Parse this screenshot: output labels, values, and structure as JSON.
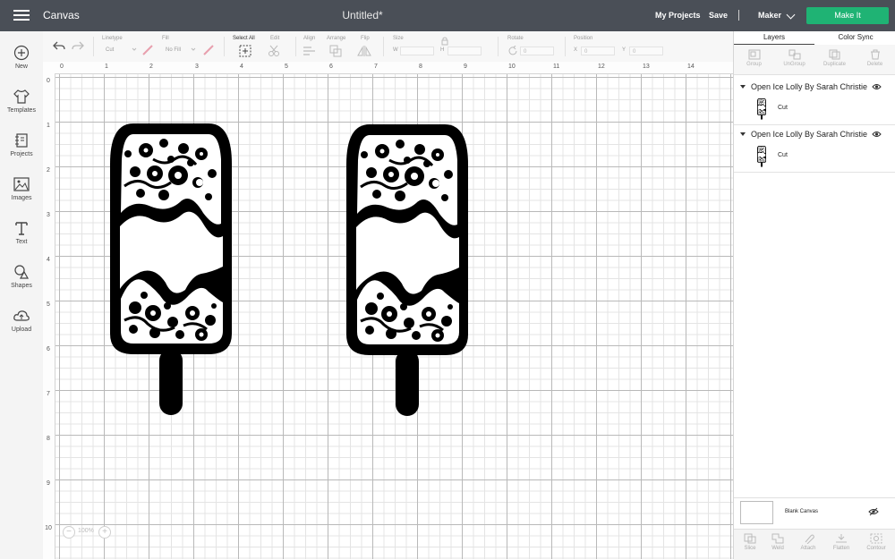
{
  "header": {
    "app_title": "Canvas",
    "document_title": "Untitled*",
    "my_projects": "My Projects",
    "save": "Save",
    "machine": "Maker",
    "make_it": "Make It"
  },
  "sidebar": {
    "items": [
      {
        "label": "New",
        "icon": "plus-circle-icon"
      },
      {
        "label": "Templates",
        "icon": "shirt-icon"
      },
      {
        "label": "Projects",
        "icon": "notebook-icon"
      },
      {
        "label": "Images",
        "icon": "image-icon"
      },
      {
        "label": "Text",
        "icon": "text-icon"
      },
      {
        "label": "Shapes",
        "icon": "shapes-icon"
      },
      {
        "label": "Upload",
        "icon": "cloud-upload-icon"
      }
    ]
  },
  "toolbar": {
    "linetype_label": "Linetype",
    "linetype_value": "Cut",
    "fill_label": "Fill",
    "fill_value": "No Fill",
    "select_all": "Select All",
    "edit": "Edit",
    "align": "Align",
    "arrange": "Arrange",
    "flip": "Flip",
    "size": "Size",
    "width_label": "W",
    "height_label": "H",
    "rotate": "Rotate",
    "position": "Position",
    "x_label": "X",
    "y_label": "Y",
    "rotate_value": "0",
    "x_value": "0",
    "y_value": "0"
  },
  "rulers": {
    "top": [
      "0",
      "1",
      "2",
      "3",
      "4",
      "5",
      "6",
      "7",
      "8",
      "9",
      "10",
      "11",
      "12",
      "13",
      "14"
    ],
    "left": [
      "0",
      "1",
      "2",
      "3",
      "4",
      "5",
      "6",
      "7",
      "8",
      "9",
      "10"
    ]
  },
  "canvas": {
    "zoom": "100%"
  },
  "panel": {
    "tabs": [
      "Layers",
      "Color Sync"
    ],
    "tools": [
      "Group",
      "UnGroup",
      "Duplicate",
      "Delete"
    ],
    "groups": [
      {
        "name": "Open Ice Lolly By Sarah Christie",
        "layer": "Cut"
      },
      {
        "name": "Open Ice Lolly By Sarah Christie",
        "layer": "Cut"
      }
    ],
    "blank_canvas": "Blank Canvas",
    "bottom_tools": [
      "Slice",
      "Weld",
      "Attach",
      "Flatten",
      "Contour"
    ]
  },
  "colors": {
    "header": "#4a4f57",
    "make_it": "#1fb374",
    "design": "#000000"
  }
}
